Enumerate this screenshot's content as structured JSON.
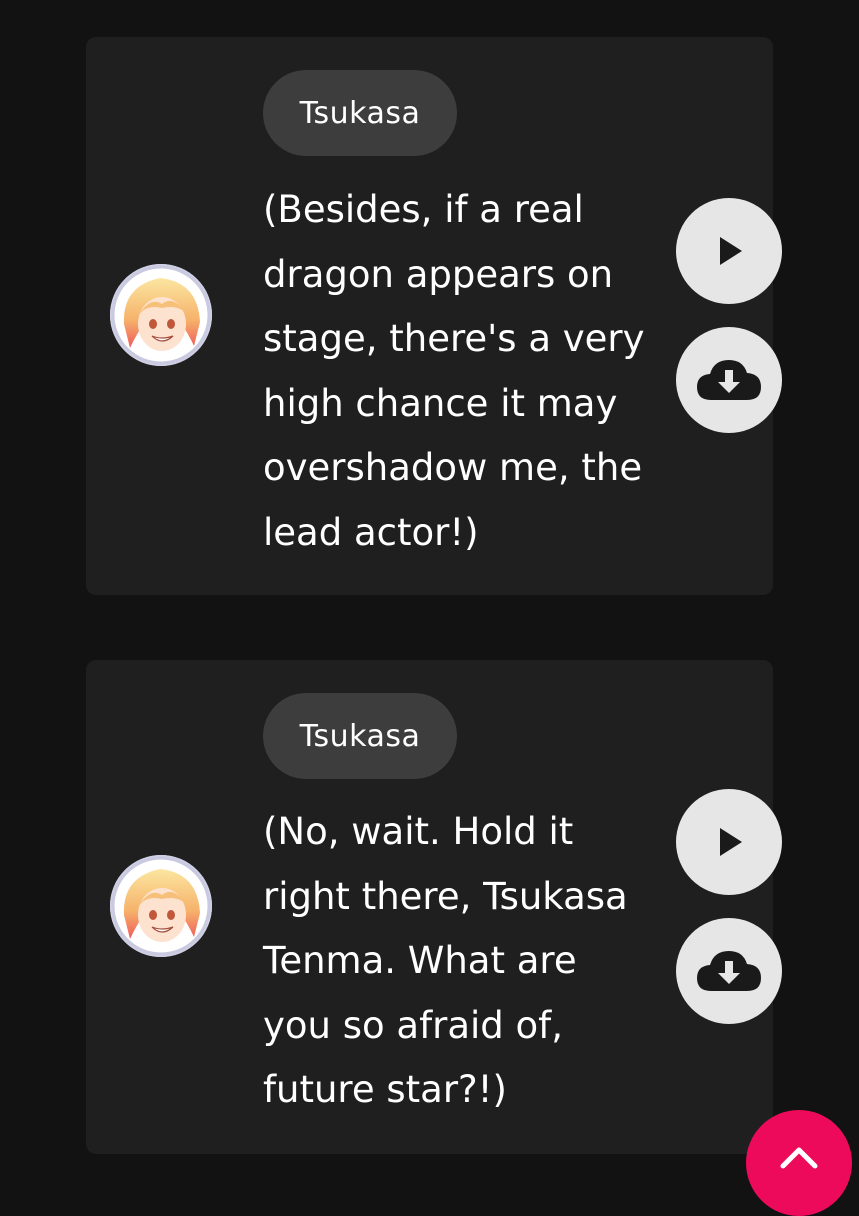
{
  "colors": {
    "background": "#121212",
    "card": "#1f1f1f",
    "chip": "#3d3d3d",
    "button": "#e6e6e6",
    "accent": "#ee0a5a"
  },
  "messages": [
    {
      "speaker": "Tsukasa",
      "text": "(Besides, if a real\ndragon appears on\nstage, there's a very\nhigh chance it may\novershadow me, the\nlead actor!)",
      "play_icon": "play-icon",
      "download_icon": "cloud-download-icon"
    },
    {
      "speaker": "Tsukasa",
      "text": "(No, wait. Hold it\nright there, Tsukasa\nTenma. What are\nyou so afraid of,\nfuture star?!)",
      "play_icon": "play-icon",
      "download_icon": "cloud-download-icon"
    }
  ],
  "scroll_top_icon": "chevron-up-icon"
}
